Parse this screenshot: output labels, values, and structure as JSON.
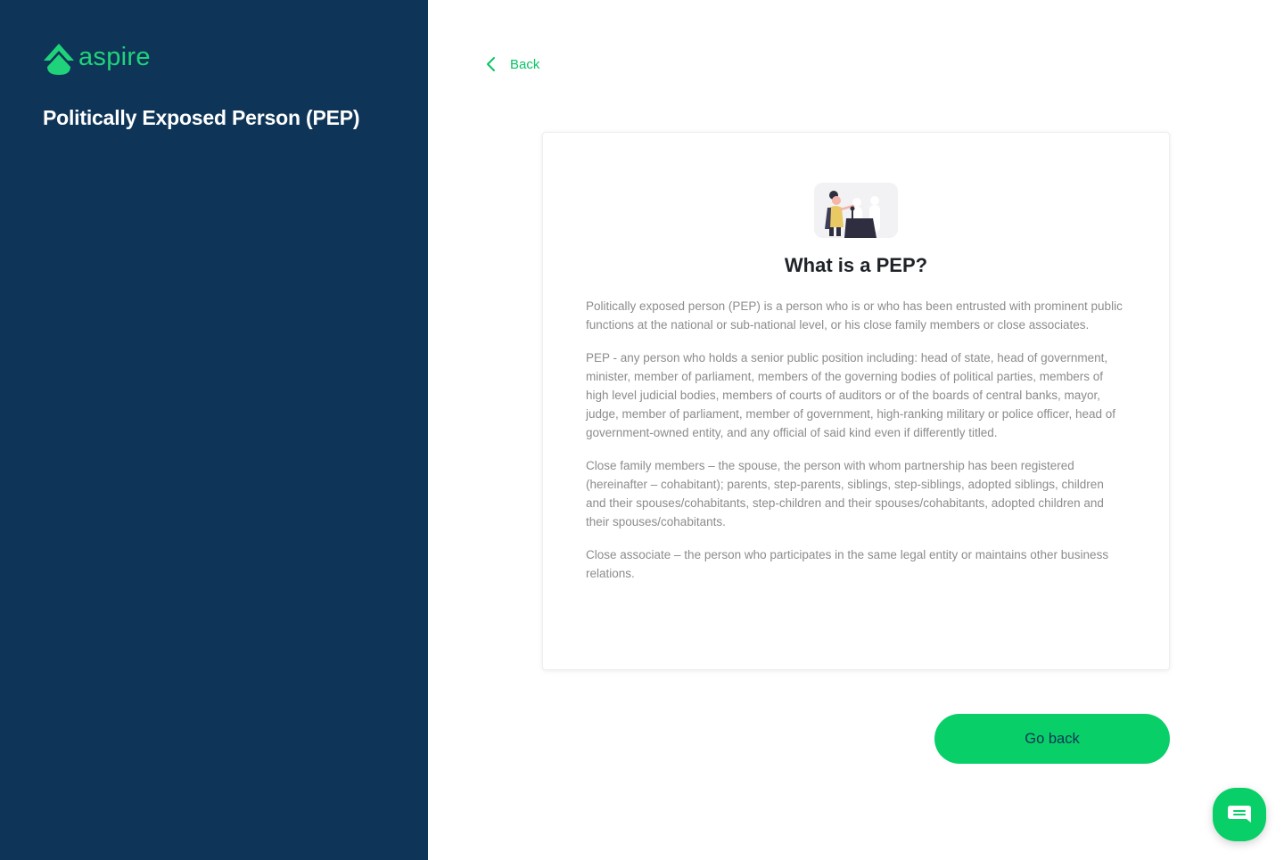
{
  "sidebar": {
    "logo_text": "aspire",
    "title": "Politically Exposed Person (PEP)"
  },
  "nav": {
    "back_label": "Back"
  },
  "card": {
    "title": "What is a PEP?",
    "paragraphs": [
      "Politically exposed person (PEP) is a person who is or who has been entrusted with prominent public functions at the national or sub-national level, or his close family members or close associates.",
      "PEP - any person who holds a senior public position including: head of state, head of government, minister, member of parliament, members of the governing bodies of political parties, members of high level judicial bodies, members of courts of auditors or of the boards of central banks, mayor, judge, member of parliament, member of government, high-ranking military or police officer, head of government-owned entity, and any official of said kind even if differently titled.",
      "Close family members – the spouse, the person with whom partnership has been registered (hereinafter – cohabitant); parents, step-parents, siblings, step-siblings, adopted siblings, children and their spouses/cohabitants, step-children and their spouses/cohabitants, adopted children and their spouses/cohabitants.",
      "Close associate – the person who participates in the same legal entity or maintains other business relations."
    ]
  },
  "actions": {
    "go_back_label": "Go back"
  },
  "colors": {
    "sidebar_bg": "#0e3558",
    "brand_green": "#1fd37a",
    "button_green": "#08cf68",
    "link_green": "#08c464"
  },
  "icons": {
    "logo": "aspire-logo-icon",
    "back": "chevron-left-icon",
    "illustration": "pep-speaker-illustration",
    "chat": "chat-bubble-icon"
  }
}
